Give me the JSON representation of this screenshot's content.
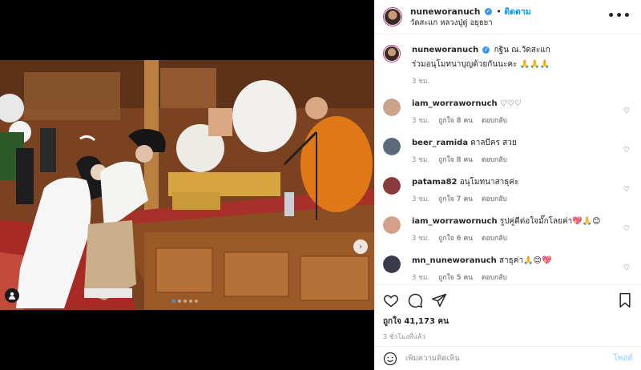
{
  "post": {
    "username": "nuneworanuch",
    "follow_label": "ติดตาม",
    "location": "วัดสะแก หลวงปู่ดู่ อยุธยา",
    "more_label": "•••"
  },
  "caption": {
    "username": "nuneworanuch",
    "line1": "กฐิน ณ.วัดสะแก",
    "line2": "ร่วมอนุโมทนาบุญด้วยกันนะคะ 🙏🙏🙏",
    "time": "3 ชม."
  },
  "comments": [
    {
      "username": "iam_worrawornuch",
      "text": "♡♡♡",
      "time": "3 ชม.",
      "likes": "ถูกใจ 8 คน",
      "reply": "ตอบกลับ",
      "avatar_color": "#c9a48a"
    },
    {
      "username": "beer_ramida",
      "text": "ดาลบีคร สวย",
      "time": "3 ชม.",
      "likes": "ถูกใจ 8 คน",
      "reply": "ตอบกลับ",
      "avatar_color": "#5a6a7a"
    },
    {
      "username": "patama82",
      "text": "อนุโมทนาสาธุค่ะ",
      "time": "3 ชม.",
      "likes": "ถูกใจ 7 คน",
      "reply": "ตอบกลับ",
      "avatar_color": "#8a3a3a"
    },
    {
      "username": "iam_worrawornuch",
      "text": "รูปคู่ดีต่อใจมั๊กโลยค่า💖🙏😊",
      "time": "3 ชม.",
      "likes": "ถูกใจ 6 คน",
      "reply": "ตอบกลับ",
      "avatar_color": "#d4a08a"
    },
    {
      "username": "mn_nuneworanuch",
      "text": "สาธุค่า🙏😊💖",
      "time": "3 ชม.",
      "likes": "ถูกใจ 5 คน",
      "reply": "ตอบกลับ",
      "avatar_color": "#3a3a4a"
    }
  ],
  "likes_label": "ถูกใจ 41,173 คน",
  "ago_label": "3 ชั่วโมงที่แล้ว",
  "comment_box": {
    "placeholder": "เพิ่มความคิดเห็น",
    "post_label": "โพสต์"
  },
  "colors": {
    "accent": "#0095f6",
    "verified": "#3897f0",
    "story_ring": "#c13584"
  },
  "carousel": {
    "total": 5,
    "active": 1
  }
}
